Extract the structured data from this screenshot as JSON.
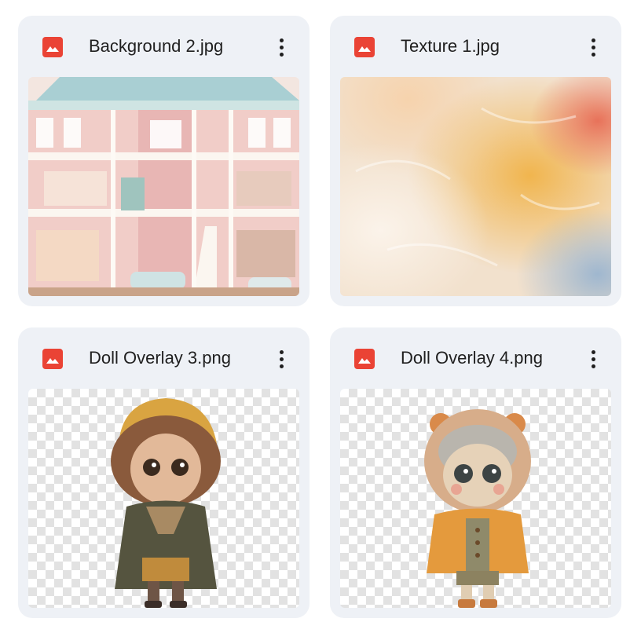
{
  "files": [
    {
      "name": "Background 2.jpg",
      "type": "image",
      "icon": "image-file-icon",
      "thumbnail": "pink-dollhouse-photo"
    },
    {
      "name": "Texture 1.jpg",
      "type": "image",
      "icon": "image-file-icon",
      "thumbnail": "painted-texture-photo"
    },
    {
      "name": "Doll Overlay 3.png",
      "type": "image",
      "icon": "image-file-icon",
      "thumbnail": "curly-hair-doll-transparent"
    },
    {
      "name": "Doll Overlay 4.png",
      "type": "image",
      "icon": "image-file-icon",
      "thumbnail": "orange-hood-doll-transparent"
    }
  ],
  "colors": {
    "card_background": "#eef1f6",
    "image_icon": "#ea4335",
    "text": "#1f1f1f"
  }
}
